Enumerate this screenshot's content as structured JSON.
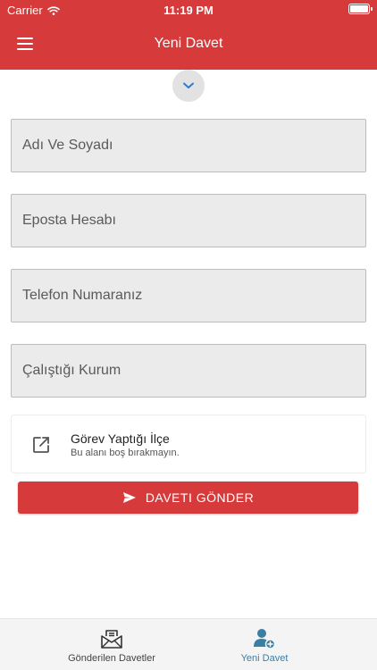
{
  "status_bar": {
    "carrier": "Carrier",
    "time": "11:19 PM"
  },
  "header": {
    "title": "Yeni Davet"
  },
  "form": {
    "name_placeholder": "Adı Ve Soyadı",
    "email_placeholder": "Eposta Hesabı",
    "phone_placeholder": "Telefon Numaranız",
    "institution_placeholder": "Çalıştığı Kurum"
  },
  "district": {
    "title": "Görev Yaptığı İlçe",
    "subtitle": "Bu alanı boş bırakmayın."
  },
  "send_button": {
    "label": "DAVETI GÖNDER"
  },
  "tabs": [
    {
      "label": "Gönderilen Davetler",
      "icon": "envelope-icon"
    },
    {
      "label": "Yeni Davet",
      "icon": "add-user-icon",
      "active": true
    }
  ],
  "colors": {
    "primary": "#d63a3a",
    "active_tab": "#3a7ea3",
    "field_bg": "#ebebeb"
  }
}
